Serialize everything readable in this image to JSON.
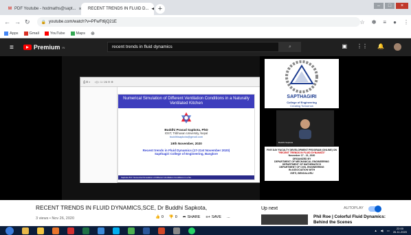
{
  "browser": {
    "tabs": [
      {
        "label": "PDF Youtube - hodmaths@sapt...",
        "active": false
      },
      {
        "label": "RECENT TRENDS IN FLUID D...",
        "active": true
      }
    ],
    "new_tab": "+",
    "url": "youtube.com/watch?v=PFwFt6jQ21E",
    "bookmarks": [
      {
        "label": "Apps",
        "color": "#4285f4"
      },
      {
        "label": "Gmail",
        "color": "#d93025"
      },
      {
        "label": "YouTube",
        "color": "#ff0000"
      },
      {
        "label": "Maps",
        "color": "#34a853"
      }
    ]
  },
  "youtube": {
    "logo_text": "Premium",
    "logo_sup": "IN",
    "search_value": "recent trends in fluid dynamics"
  },
  "slide": {
    "title": "Numerical Simulation of Different Ventilation Conditions in a Naturally Ventilated Kitchen",
    "presenter": "Buddhi Prasad Sapkota, PhD",
    "affiliation": "IOST, Tribhuvan University, Nepal",
    "email": "buddhisapkota@gmail.com",
    "date": "19th November, 2020",
    "event": "Recent trends in Fluid Dynamics (17-21st November 2020)",
    "college": "Sapthagiri College of Engineering, Banglore",
    "footer": "Sapkota B.P.       Numerical Simulation of Different Ventilation Conditions in a Na"
  },
  "college_panel": {
    "name": "SAPTHAGIRI",
    "sub": "College of Engineering",
    "tag": "Creating Tomorrow",
    "cam_label": "Buddhi Sapkota"
  },
  "programme": {
    "line1": "FIVE DAY FACULTY DEVELOPMENT PROGRAM (ONLINE) ON",
    "line2": "\"RECENT TRENDS IN FLUID DYNAMICS\"",
    "line3": "November 17 - 21, 2020",
    "line4": "ORGANIZED BY",
    "line5": "DEPARTMENT OF MECHANICAL ENGINEERING",
    "line6": "DEPARTMENT OF MATHEMATICS",
    "line7": "DEPARTMENT OF CIVIL ENGINEERING",
    "line8": "IN ASSOCIATION WITH",
    "line9": "ISRTI, BENGALURU"
  },
  "video": {
    "title": "RECENT TRENDS IN FLUID DYNAMICS,SCE, Dr Buddhi Sapkota,",
    "meta": "3 views • Nov 26, 2020",
    "likes": "0",
    "dislikes": "0",
    "share": "SHARE",
    "save": "SAVE",
    "more": "..."
  },
  "sidebar": {
    "up_next": "Up next",
    "autoplay": "AUTOPLAY",
    "next_title": "Phil Roe | Colorful Fluid Dynamics: Behind the Scenes"
  },
  "taskbar": {
    "time": "22:00",
    "date": "26-11-2020"
  }
}
